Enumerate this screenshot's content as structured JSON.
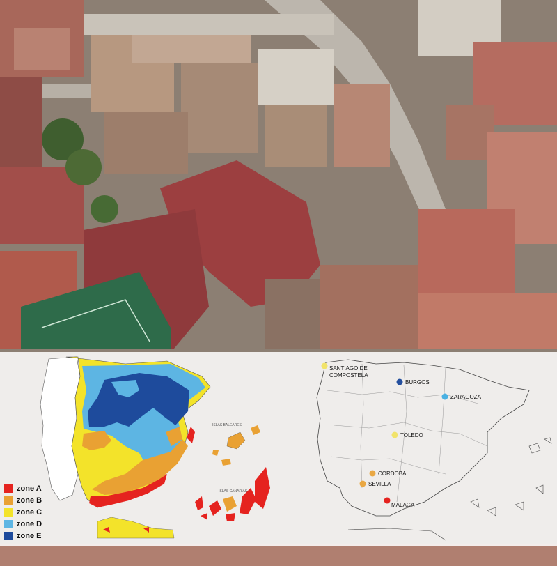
{
  "legend": {
    "items": [
      {
        "label": "zone A",
        "color": "#e5231f"
      },
      {
        "label": "zone B",
        "color": "#e9a133"
      },
      {
        "label": "zone C",
        "color": "#f3e32a"
      },
      {
        "label": "zone D",
        "color": "#5db5e3"
      },
      {
        "label": "zone E",
        "color": "#1e4b9c"
      }
    ]
  },
  "cities": [
    {
      "name": "SANTIAGO DE",
      "name2": "COMPOSTELA",
      "zone": "C",
      "color": "#f1e36a"
    },
    {
      "name": "BURGOS",
      "zone": "E",
      "color": "#244f9e"
    },
    {
      "name": "ZARAGOZA",
      "zone": "D",
      "color": "#4ab1e2"
    },
    {
      "name": "TOLEDO",
      "zone": "C",
      "color": "#f1e36a"
    },
    {
      "name": "CORDOBA",
      "zone": "B",
      "color": "#e9a844"
    },
    {
      "name": "SEVILLA",
      "zone": "B",
      "color": "#e9a844"
    },
    {
      "name": "MALAGA",
      "zone": "A",
      "color": "#e5231f"
    }
  ],
  "map_labels": {
    "balearic": "ISLAS BALEARES",
    "canarias": "ISLAS CANARIAS"
  },
  "colors": {
    "roof_terracotta": "#a65b4c",
    "roof_red": "#9c3e3e",
    "court_green": "#2e6b4a",
    "overlay_white": "#ffffff"
  }
}
